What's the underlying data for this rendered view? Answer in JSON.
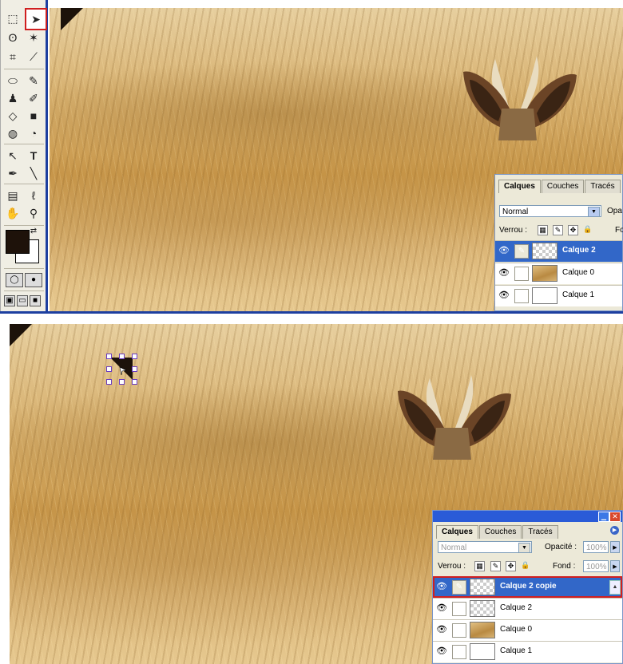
{
  "toolbox": {
    "tools": [
      {
        "icon": "marquee-icon",
        "glyph": "⬚"
      },
      {
        "icon": "move-tool-icon",
        "glyph": "➤",
        "selected": true
      },
      {
        "icon": "lasso-icon",
        "glyph": "ʘ"
      },
      {
        "icon": "magic-wand-icon",
        "glyph": "✶"
      },
      {
        "icon": "crop-icon",
        "glyph": "⌗"
      },
      {
        "icon": "slice-icon",
        "glyph": "⟋"
      },
      {
        "icon": "healing-brush-icon",
        "glyph": "⬭"
      },
      {
        "icon": "brush-icon",
        "glyph": "✎"
      },
      {
        "icon": "clone-stamp-icon",
        "glyph": "♟"
      },
      {
        "icon": "history-brush-icon",
        "glyph": "✐"
      },
      {
        "icon": "eraser-icon",
        "glyph": "◇"
      },
      {
        "icon": "gradient-icon",
        "glyph": "■"
      },
      {
        "icon": "blur-icon",
        "glyph": "◍"
      },
      {
        "icon": "dodge-icon",
        "glyph": "◔"
      },
      {
        "icon": "path-selection-icon",
        "glyph": "↖"
      },
      {
        "icon": "type-icon",
        "glyph": "T"
      },
      {
        "icon": "pen-icon",
        "glyph": "✒"
      },
      {
        "icon": "line-icon",
        "glyph": "╲"
      },
      {
        "icon": "notes-icon",
        "glyph": "▤"
      },
      {
        "icon": "eyedropper-icon",
        "glyph": "ℓ"
      },
      {
        "icon": "hand-icon",
        "glyph": "✋"
      },
      {
        "icon": "zoom-icon",
        "glyph": "⚲"
      }
    ],
    "foreground_color": "#1e120a",
    "background_color": "#ffffff"
  },
  "panel_top": {
    "tabs": [
      "Calques",
      "Couches",
      "Tracés"
    ],
    "blend_mode": "Normal",
    "opacity_label": "Opa",
    "lock_label": "Verrou :",
    "fill_label": "Fo",
    "layers": [
      {
        "name": "Calque 2",
        "thumb": "transparent",
        "selected": true,
        "brush": true
      },
      {
        "name": "Calque 0",
        "thumb": "wheat",
        "selected": false
      },
      {
        "name": "Calque 1",
        "thumb": "white",
        "selected": false
      }
    ]
  },
  "panel_bottom": {
    "tabs": [
      "Calques",
      "Couches",
      "Tracés"
    ],
    "blend_mode": "Normal",
    "opacity_label": "Opacité :",
    "opacity_value": "100%",
    "lock_label": "Verrou :",
    "fill_label": "Fond :",
    "fill_value": "100%",
    "layers": [
      {
        "name": "Calque 2 copie",
        "thumb": "transparent",
        "selected": true,
        "brush": true
      },
      {
        "name": "Calque 2",
        "thumb": "transparent",
        "selected": false
      },
      {
        "name": "Calque 0",
        "thumb": "wheat",
        "selected": false
      },
      {
        "name": "Calque 1",
        "thumb": "white",
        "selected": false
      }
    ]
  },
  "colors": {
    "accent": "#1d3fa0",
    "highlight_red": "#d01f1f",
    "layer_selected": "#3267c8"
  }
}
